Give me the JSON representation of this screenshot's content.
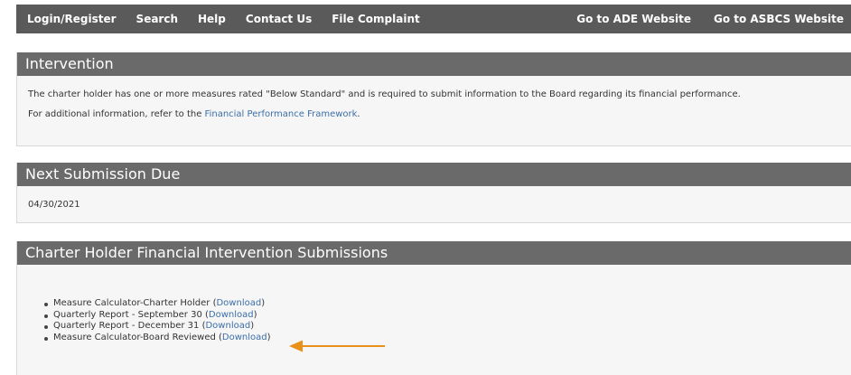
{
  "nav": {
    "left": [
      "Login/Register",
      "Search",
      "Help",
      "Contact Us",
      "File Complaint"
    ],
    "right": [
      "Go to ADE Website",
      "Go to ASBCS Website"
    ]
  },
  "intervention": {
    "title": "Intervention",
    "text1": "The charter holder has one or more measures rated \"Below Standard\" and is required to submit information to the Board regarding its financial performance.",
    "text2_prefix": "For additional information, refer to the ",
    "text2_link": "Financial Performance Framework",
    "text2_suffix": "."
  },
  "next_submission": {
    "title": "Next Submission Due",
    "date": "04/30/2021"
  },
  "submissions": {
    "title": "Charter Holder Financial Intervention Submissions",
    "items": [
      {
        "label": "Measure Calculator-Charter Holder",
        "link": "Download"
      },
      {
        "label": "Quarterly Report - September 30",
        "link": "Download"
      },
      {
        "label": "Quarterly Report - December 31",
        "link": "Download"
      },
      {
        "label": "Measure Calculator-Board Reviewed",
        "link": "Download"
      }
    ]
  },
  "colors": {
    "nav_bg": "#5a5a5a",
    "header_bg": "#6a6a6a",
    "link": "#3b6fa8",
    "arrow": "#e8901a"
  }
}
